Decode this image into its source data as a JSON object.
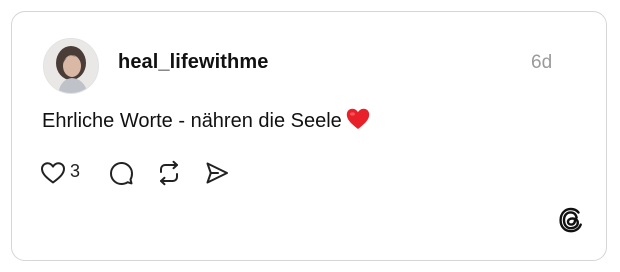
{
  "post": {
    "username": "heal_lifewithme",
    "time": "6d",
    "text": "Ehrliche Worte - nähren die Seele",
    "emoji": "red-heart-emoji"
  },
  "actions": {
    "like_count": "3",
    "like_icon": "heart-outline-icon",
    "reply_icon": "comment-icon",
    "repost_icon": "repost-icon",
    "share_icon": "send-icon"
  },
  "brand": {
    "logo": "threads-logo-icon"
  },
  "colors": {
    "text": "#111111",
    "muted": "#9a9a9a",
    "border": "#d6d6d6",
    "heart": "#e8202a"
  }
}
